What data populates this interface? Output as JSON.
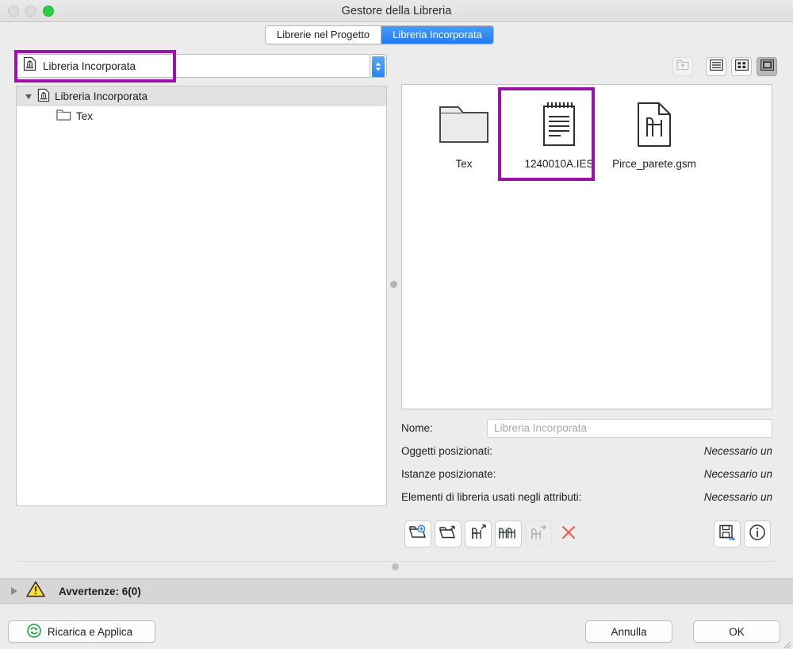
{
  "window": {
    "title": "Gestore della Libreria",
    "traffic_lights": [
      "close",
      "minimize",
      "zoom"
    ]
  },
  "tabs": [
    {
      "label": "Librerie nel Progetto",
      "active": false
    },
    {
      "label": "Libreria Incorporata",
      "active": true
    }
  ],
  "combo": {
    "value": "Libreria Incorporata",
    "icon": "embedded-library-icon",
    "stepper_icon": "stepper-up-down-icon"
  },
  "tree": {
    "items": [
      {
        "label": "Libreria Incorporata",
        "icon": "embedded-library-icon",
        "level": 0,
        "expanded": true,
        "selected": true
      },
      {
        "label": "Tex",
        "icon": "folder-icon",
        "level": 1,
        "expanded": false,
        "selected": false
      }
    ]
  },
  "view_buttons": [
    {
      "name": "go-up-folder",
      "icon": "folder-up-icon",
      "state": "disabled"
    },
    {
      "name": "list-view",
      "icon": "list-view-icon",
      "state": "normal"
    },
    {
      "name": "grid-view",
      "icon": "grid-view-icon",
      "state": "normal"
    },
    {
      "name": "icon-view",
      "icon": "icon-view-icon",
      "state": "pressed"
    }
  ],
  "browser": {
    "files": [
      {
        "label": "Tex",
        "icon": "folder-icon",
        "selected": false
      },
      {
        "label": "1240010A.IES",
        "icon": "ies-notepad-file-icon",
        "selected": true
      },
      {
        "label": "Pirce_parete.gsm",
        "icon": "gsm-object-file-icon",
        "selected": false
      }
    ]
  },
  "details": {
    "name_label": "Nome:",
    "name_placeholder": "Libreria Incorporata",
    "rows": [
      {
        "label": "Oggetti posizionati:",
        "value": "Necessario un"
      },
      {
        "label": "Istanze posizionate:",
        "value": "Necessario un"
      },
      {
        "label": "Elementi di libreria usati negli attributi:",
        "value": "Necessario un"
      }
    ]
  },
  "toolbar": {
    "left": [
      {
        "name": "add-library-button",
        "icon": "folder-plus-icon",
        "state": "normal"
      },
      {
        "name": "open-library-button",
        "icon": "folder-arrow-icon",
        "state": "normal"
      },
      {
        "name": "add-object-button",
        "icon": "chair-arrow-up-icon",
        "state": "normal"
      },
      {
        "name": "add-objects-button",
        "icon": "chairs-arrow-icon",
        "state": "normal"
      },
      {
        "name": "export-object-button",
        "icon": "chair-arrow-right-icon",
        "state": "disabled"
      },
      {
        "name": "delete-button",
        "icon": "close-x-icon",
        "state": "normal"
      }
    ],
    "right": [
      {
        "name": "save-button",
        "icon": "save-disk-arrow-icon",
        "state": "normal"
      },
      {
        "name": "info-button",
        "icon": "info-circle-icon",
        "state": "normal"
      }
    ]
  },
  "warnings": {
    "label": "Avvertenze: 6(0)",
    "icon": "warning-triangle-icon",
    "expanded": false
  },
  "footer": {
    "reload_label": "Ricarica e Applica",
    "reload_icon": "refresh-circle-icon",
    "cancel_label": "Annulla",
    "ok_label": "OK"
  },
  "highlights": [
    {
      "name": "combo-highlight",
      "color": "#9b12a6"
    },
    {
      "name": "selected-file-highlight",
      "color": "#9b12a6"
    }
  ],
  "colors": {
    "accent_blue": "#2a84f2",
    "highlight_purple": "#9b12a6",
    "warning_yellow": "#ffe02a",
    "delete_red": "#f05a4a",
    "reload_green": "#18a63a",
    "window_bg": "#ececec"
  }
}
